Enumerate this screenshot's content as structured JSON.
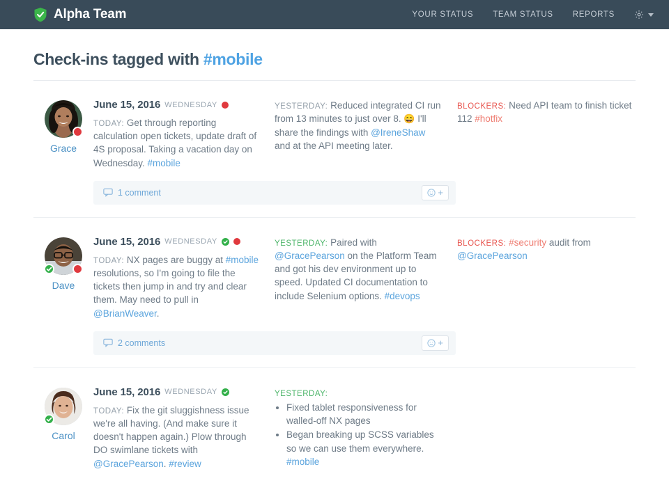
{
  "nav": {
    "brand": "Alpha Team",
    "brand_icon": "shield-check-icon",
    "links": [
      {
        "label": "YOUR STATUS",
        "name": "your-status"
      },
      {
        "label": "TEAM STATUS",
        "name": "team-status"
      },
      {
        "label": "REPORTS",
        "name": "reports"
      }
    ],
    "settings_icon": "gear-icon",
    "settings_caret": "chevron-down-icon",
    "bg_color": "#394b59"
  },
  "page": {
    "title_prefix": "Check-ins tagged with ",
    "title_tag": "#mobile",
    "tag_color": "#4fa3e3"
  },
  "checkins": [
    {
      "user": "Grace",
      "avatar_badges": [
        "red-dot-badge"
      ],
      "date": "June 15, 2016",
      "day": "WEDNESDAY",
      "status_dots": [
        "red"
      ],
      "today_label": "TODAY:",
      "today_text_1": " Get through reporting calculation open tickets, update draft of 4S proposal. Taking a vacation day on Wednesday. ",
      "today_tag": "#mobile",
      "yesterday_label": "YESTERDAY:",
      "yesterday_label_color": "gray",
      "yesterday_text_1": " Reduced integrated CI run from 13 minutes to just over 8. ",
      "yesterday_emoji": "😄",
      "yesterday_text_2": " I'll share the findings with ",
      "yesterday_mention": "@IreneShaw",
      "yesterday_text_3": " and at the API meeting later.",
      "blockers_label": "BLOCKERS:",
      "blockers_text_1": " Need API team to finish ticket 112 ",
      "blockers_tag": "#hotfix",
      "comment_count": "1 comment",
      "has_action_bar": true
    },
    {
      "user": "Dave",
      "avatar_badges": [
        "green-check-badge",
        "red-dot-badge"
      ],
      "date": "June 15, 2016",
      "day": "WEDNESDAY",
      "status_dots": [
        "green",
        "red"
      ],
      "today_label": "TODAY:",
      "today_text_1": " NX pages are buggy at ",
      "today_tag": "#mobile",
      "today_text_2": " resolutions, so I'm going to file the tickets then jump in and try and clear them. May need to pull in ",
      "today_mention": "@BrianWeaver",
      "today_text_3": ".",
      "yesterday_label": "YESTERDAY:",
      "yesterday_label_color": "green",
      "yesterday_text_1": " Paired with ",
      "yesterday_mention": "@GracePearson",
      "yesterday_text_2": " on the Platform Team and got his dev environment up to speed. Updated CI documentation to include Selenium options. ",
      "yesterday_tag": "#devops",
      "blockers_label": "BLOCKERS:",
      "blockers_tag": "#security",
      "blockers_text_1": " audit from ",
      "blockers_mention": "@GracePearson",
      "comment_count": "2 comments",
      "has_action_bar": true
    },
    {
      "user": "Carol",
      "avatar_badges": [
        "green-check-badge"
      ],
      "date": "June 15, 2016",
      "day": "WEDNESDAY",
      "status_dots": [
        "green"
      ],
      "today_label": "TODAY:",
      "today_text_1": " Fix the git sluggishness issue we're all having. (And make sure it doesn't happen again.) Plow through DO swimlane tickets with ",
      "today_mention": "@GracePearson",
      "today_text_2": ". ",
      "today_tag": "#review",
      "yesterday_label": "YESTERDAY:",
      "yesterday_label_color": "green",
      "bullets": [
        {
          "text_1": "Fixed tablet responsiveness for walled-off NX pages"
        },
        {
          "text_1": "Began breaking up SCSS variables so we can use them everywhere. ",
          "tag": "#mobile"
        }
      ],
      "has_action_bar": false
    }
  ],
  "action_bar": {
    "comment_icon": "comment-bubble-icon",
    "react_icon": "emoji-smiley-icon",
    "react_plus": "+"
  }
}
